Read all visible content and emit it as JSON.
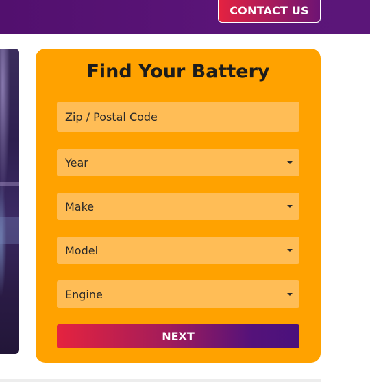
{
  "header": {
    "contact_label": "CONTACT US"
  },
  "form": {
    "title": "Find Your Battery",
    "zip_placeholder": "Zip / Postal Code",
    "year_value": "Year",
    "make_value": "Make",
    "model_value": "Model",
    "engine_value": "Engine",
    "next_label": "NEXT"
  },
  "icons": {
    "dropdown": "caret-down-icon"
  },
  "colors": {
    "card_background": "#ffa200",
    "field_background": "#ffbd56",
    "header_purple": "#5a1478",
    "button_gradient_start": "#e5233f",
    "button_gradient_end": "#4a117c"
  }
}
